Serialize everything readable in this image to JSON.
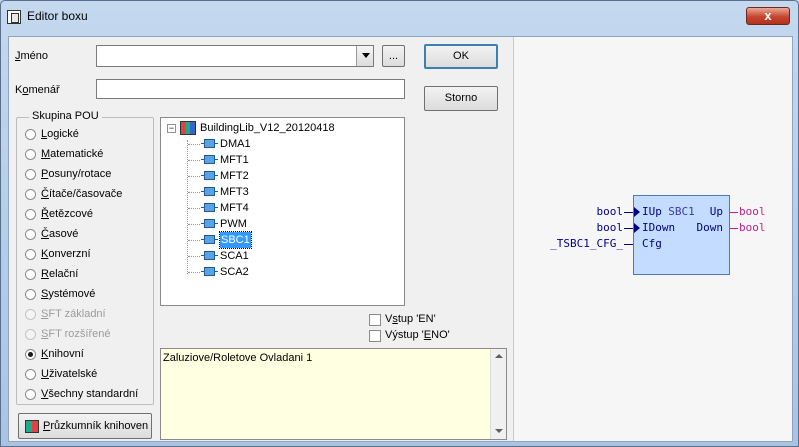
{
  "window": {
    "title": "Editor boxu",
    "close_glyph": "x"
  },
  "form": {
    "name_label": "Jméno",
    "name_value": "",
    "browse_label": "...",
    "ok_label": "OK",
    "comment_label": "Komenář",
    "comment_value": "",
    "cancel_label": "Storno"
  },
  "pou_group": {
    "title": "Skupina POU",
    "options": [
      {
        "label": "Logické",
        "checked": false,
        "disabled": false
      },
      {
        "label": "Matematické",
        "checked": false,
        "disabled": false
      },
      {
        "label": "Posuny/rotace",
        "checked": false,
        "disabled": false
      },
      {
        "label": "Čítače/časovače",
        "checked": false,
        "disabled": false
      },
      {
        "label": "Řetězcové",
        "checked": false,
        "disabled": false
      },
      {
        "label": "Časové",
        "checked": false,
        "disabled": false
      },
      {
        "label": "Konverzní",
        "checked": false,
        "disabled": false
      },
      {
        "label": "Relační",
        "checked": false,
        "disabled": false
      },
      {
        "label": "Systémové",
        "checked": false,
        "disabled": false
      },
      {
        "label": "SFT základní",
        "checked": false,
        "disabled": true
      },
      {
        "label": "SFT rozšířené",
        "checked": false,
        "disabled": true
      },
      {
        "label": "Knihovní",
        "checked": true,
        "disabled": false
      },
      {
        "label": "Uživatelské",
        "checked": false,
        "disabled": false
      },
      {
        "label": "Všechny standardní",
        "checked": false,
        "disabled": false
      }
    ]
  },
  "tree": {
    "root": "BuildingLib_V12_20120418",
    "items": [
      "DMA1",
      "MFT1",
      "MFT2",
      "MFT3",
      "MFT4",
      "PWM",
      "SBC1",
      "SCA1",
      "SCA2"
    ],
    "selected": "SBC1"
  },
  "options": {
    "en_label": "Vstup 'EN'",
    "eno_label": "Výstup 'ENO'",
    "en_checked": false,
    "eno_checked": false
  },
  "description": {
    "text": "Zaluziove/Roletove Ovladani 1"
  },
  "explorer_button": {
    "label": "Průzkumník knihoven",
    "icon": "book-icon"
  },
  "block_preview": {
    "name": "SBC1",
    "inputs": [
      {
        "type": "bool",
        "pin": "IUp",
        "edge": true
      },
      {
        "type": "bool",
        "pin": "IDown",
        "edge": true
      },
      {
        "type": "_TSBC1_CFG_",
        "pin": "Cfg",
        "edge": false
      }
    ],
    "outputs": [
      {
        "type": "bool",
        "pin": "Up"
      },
      {
        "type": "bool",
        "pin": "Down"
      }
    ],
    "colors": {
      "box_fill": "#c4dcff",
      "input_type": "#00008b",
      "output_type": "#c0208c"
    }
  }
}
